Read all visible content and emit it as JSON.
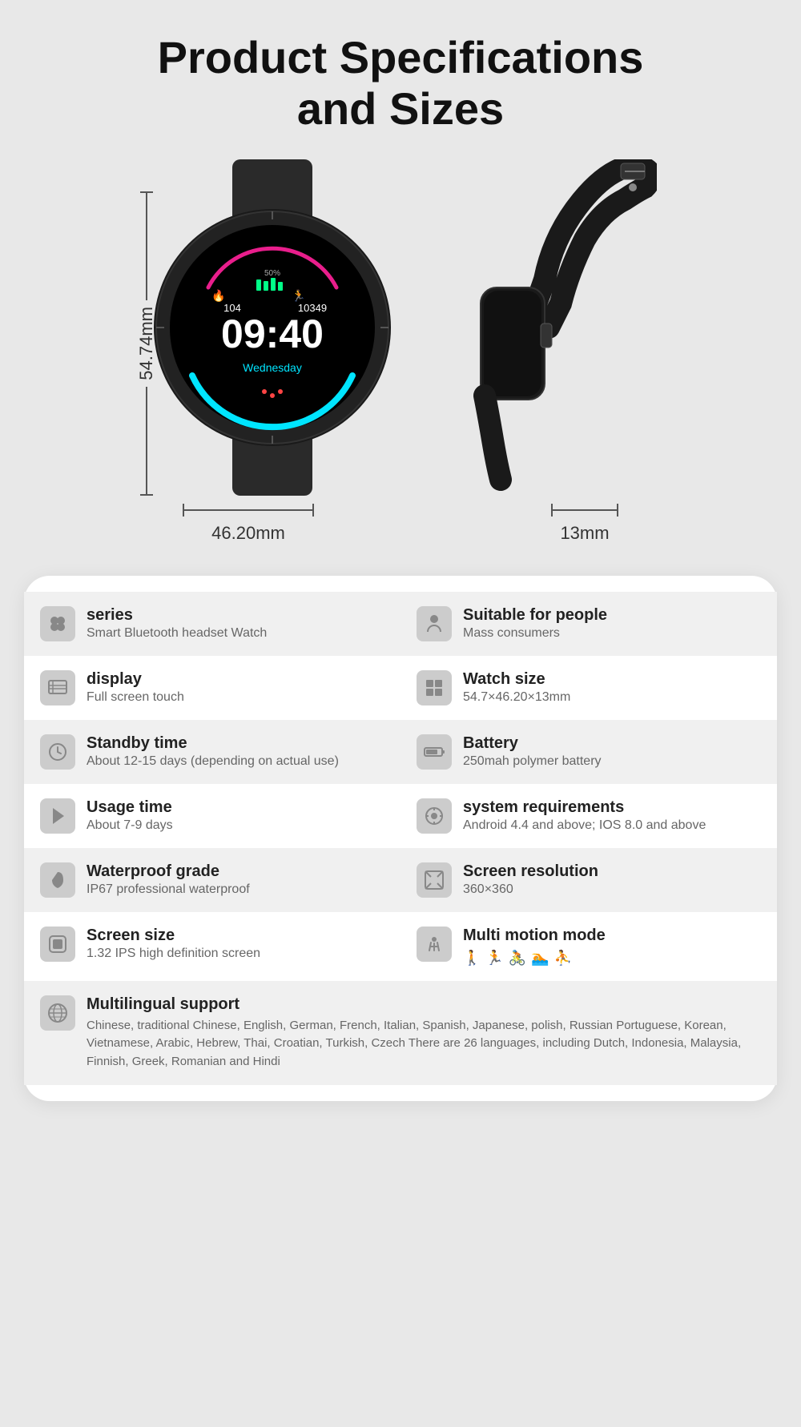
{
  "page": {
    "title_line1": "Product Specifications",
    "title_line2": "and Sizes",
    "dim_height": "54.74mm",
    "dim_width": "46.20mm",
    "dim_depth": "13mm"
  },
  "specs": {
    "rows": [
      {
        "shaded": true,
        "cells": [
          {
            "icon": "⬡",
            "icon_name": "series-icon",
            "title": "series",
            "value": "Smart Bluetooth headset Watch"
          },
          {
            "icon": "👤",
            "icon_name": "people-icon",
            "title": "Suitable for people",
            "value": "Mass consumers"
          }
        ]
      },
      {
        "shaded": false,
        "cells": [
          {
            "icon": "▤",
            "icon_name": "display-icon",
            "title": "display",
            "value": "Full screen touch"
          },
          {
            "icon": "⬛",
            "icon_name": "watch-size-icon",
            "title": "Watch size",
            "value": "54.7×46.20×13mm"
          }
        ]
      },
      {
        "shaded": true,
        "cells": [
          {
            "icon": "⏱",
            "icon_name": "standby-icon",
            "title": "Standby time",
            "value": "About 12-15 days (depending on actual use)"
          },
          {
            "icon": "🔋",
            "icon_name": "battery-icon",
            "title": "Battery",
            "value": "250mah polymer battery"
          }
        ]
      },
      {
        "shaded": false,
        "cells": [
          {
            "icon": "⚡",
            "icon_name": "usage-icon",
            "title": "Usage time",
            "value": "About 7-9 days"
          },
          {
            "icon": "⚙",
            "icon_name": "system-icon",
            "title": "system requirements",
            "value": "Android 4.4 and above; IOS 8.0 and above"
          }
        ]
      },
      {
        "shaded": true,
        "cells": [
          {
            "icon": "💧",
            "icon_name": "water-icon",
            "title": "Waterproof grade",
            "value": "IP67 professional waterproof"
          },
          {
            "icon": "⤢",
            "icon_name": "resolution-icon",
            "title": "Screen resolution",
            "value": "360×360"
          }
        ]
      },
      {
        "shaded": false,
        "cells": [
          {
            "icon": "📱",
            "icon_name": "screen-size-icon",
            "title": "Screen size",
            "value": "1.32 IPS high definition screen"
          },
          {
            "icon": "🏃",
            "icon_name": "motion-icon",
            "title": "Multi motion mode",
            "value": "motion_icons"
          }
        ]
      },
      {
        "shaded": true,
        "multilingual": true,
        "icon": "🌐",
        "icon_name": "language-icon",
        "title": "Multilingual support",
        "value": "Chinese, traditional Chinese, English, German, French, Italian, Spanish, Japanese, polish, Russian Portuguese, Korean, Vietnamese, Arabic, Hebrew, Thai, Croatian, Turkish, Czech There are 26 languages, including Dutch, Indonesia, Malaysia, Finnish, Greek, Romanian and Hindi"
      }
    ]
  }
}
